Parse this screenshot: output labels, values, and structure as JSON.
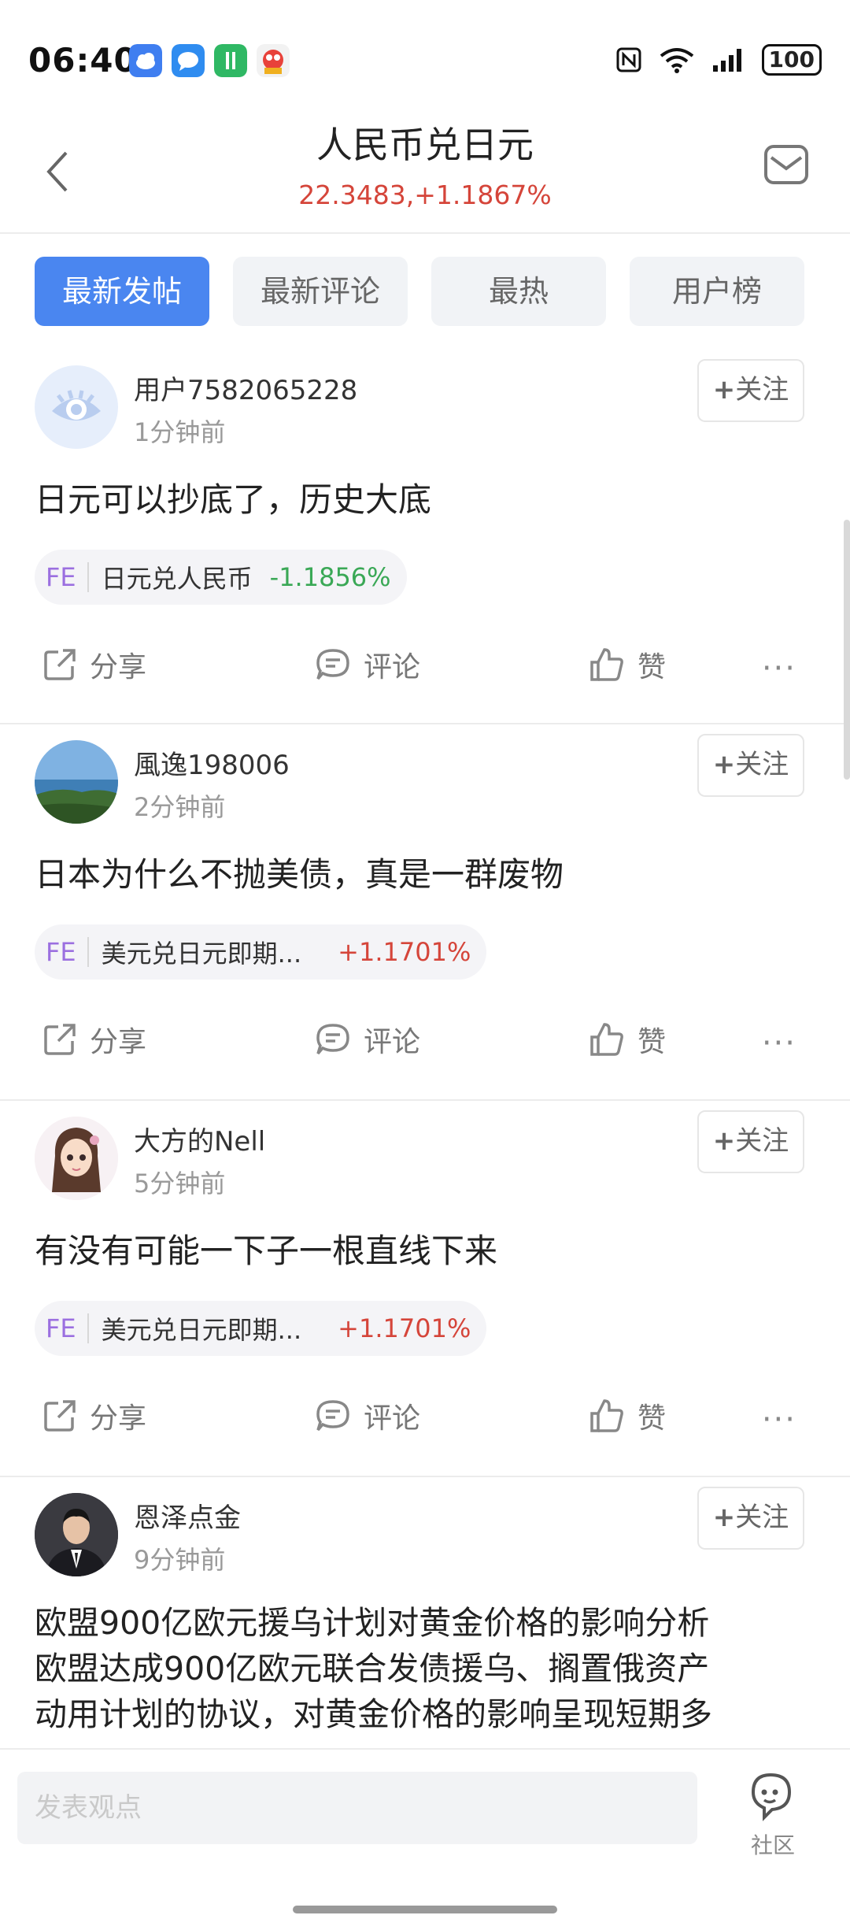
{
  "status_bar": {
    "time": "06:40",
    "battery": "100",
    "app_icons": [
      "cloud-app-icon",
      "chat-app-icon",
      "green-app-icon",
      "game-app-icon"
    ]
  },
  "header": {
    "title": "人民币兑日元",
    "quote": "22.3483,+1.1867%"
  },
  "tabs": [
    {
      "label": "最新发帖",
      "active": true
    },
    {
      "label": "最新评论",
      "active": false
    },
    {
      "label": "最热",
      "active": false
    },
    {
      "label": "用户榜",
      "active": false
    }
  ],
  "actions": {
    "share": "分享",
    "comment": "评论",
    "like": "赞",
    "more": "···"
  },
  "follow_label": "关注",
  "posts": [
    {
      "username": "用户7582065228",
      "time": "1分钟前",
      "content": "日元可以抄底了，历史大底",
      "tag": {
        "prefix": "FE",
        "name": "日元兑人民币",
        "change": "-1.1856%"
      }
    },
    {
      "username": "風逸198006",
      "time": "2分钟前",
      "content": "日本为什么不抛美债，真是一群废物",
      "tag": {
        "prefix": "FE",
        "name": "美元兑日元即期...",
        "change": "+1.1701%"
      }
    },
    {
      "username": "大方的Nell",
      "time": "5分钟前",
      "content": "有没有可能一下子一根直线下来",
      "tag": {
        "prefix": "FE",
        "name": "美元兑日元即期...",
        "change": "+1.1701%"
      }
    },
    {
      "username": "恩泽点金",
      "time": "9分钟前",
      "content_lines": [
        "欧盟900亿欧元援乌计划对黄金价格的影响分析",
        "欧盟达成900亿欧元联合发债援乌、搁置俄资产",
        "动用计划的协议，对黄金价格的影响呈现短期多"
      ]
    }
  ],
  "bottom": {
    "input_placeholder": "发表观点",
    "community_label": "社区"
  },
  "colors": {
    "accent": "#4a86f0",
    "up": "#d5453a",
    "down": "#3aa856",
    "fe": "#9b6fe0"
  }
}
